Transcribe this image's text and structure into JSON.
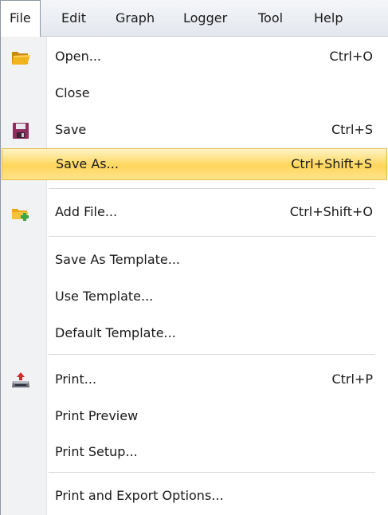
{
  "menubar": {
    "items": [
      "File",
      "Edit",
      "Graph",
      "Logger",
      "Tool",
      "Help"
    ]
  },
  "file_menu": {
    "items": [
      {
        "label": "Open...",
        "shortcut": "Ctrl+O",
        "icon": "open-folder-icon"
      },
      {
        "label": "Close",
        "shortcut": ""
      },
      {
        "label": "Save",
        "shortcut": "Ctrl+S",
        "icon": "save-disk-icon"
      },
      {
        "label": "Save As...",
        "shortcut": "Ctrl+Shift+S",
        "highlighted": true
      },
      {
        "label": "Add File...",
        "shortcut": "Ctrl+Shift+O",
        "icon": "add-file-icon"
      },
      {
        "label": "Save As Template...",
        "shortcut": ""
      },
      {
        "label": "Use Template...",
        "shortcut": ""
      },
      {
        "label": "Default Template...",
        "shortcut": ""
      },
      {
        "label": "Print...",
        "shortcut": "Ctrl+P",
        "icon": "print-icon"
      },
      {
        "label": "Print Preview",
        "shortcut": ""
      },
      {
        "label": "Print Setup...",
        "shortcut": ""
      },
      {
        "label": "Print and Export Options...",
        "shortcut": ""
      }
    ]
  },
  "colors": {
    "highlight": "#ffd65c",
    "gutter": "#f1f2f4",
    "save_icon": "#8e2d5e",
    "folder_icon": "#e8a818"
  }
}
